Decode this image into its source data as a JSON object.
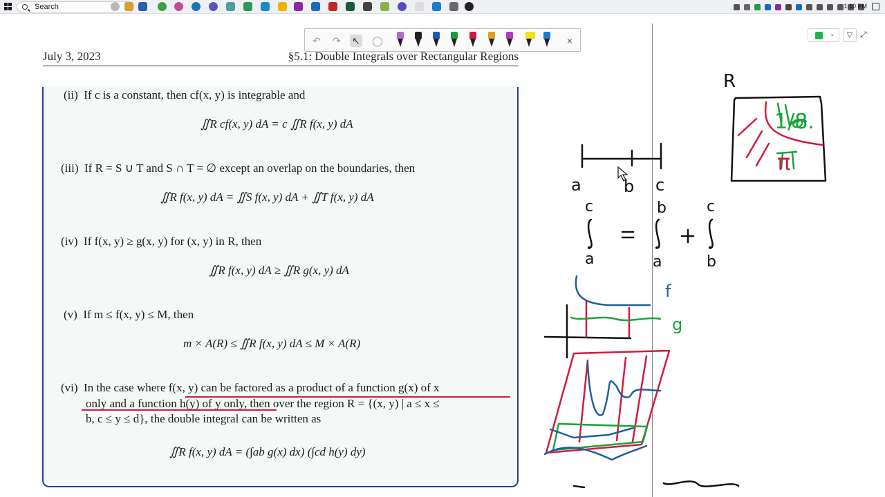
{
  "taskbar": {
    "search_label": "Search",
    "clock": "1:10 PM"
  },
  "document": {
    "header_date": "July 3, 2023",
    "header_title": "§5.1: Double Integrals over Rectangular Regions",
    "items": [
      {
        "num": "(ii)",
        "text": "If c is a constant, then cf(x, y) is integrable and",
        "equation": "∬R cf(x, y) dA = c ∬R f(x, y) dA"
      },
      {
        "num": "(iii)",
        "text": "If R = S ∪ T and S ∩ T = ∅ except an overlap on the boundaries, then",
        "equation": "∬R f(x, y) dA = ∬S f(x, y) dA + ∬T f(x, y) dA"
      },
      {
        "num": "(iv)",
        "text": "If f(x, y) ≥ g(x, y) for (x, y) in R, then",
        "equation": "∬R f(x, y) dA ≥ ∬R g(x, y) dA"
      },
      {
        "num": "(v)",
        "text": "If m ≤ f(x, y) ≤ M, then",
        "equation": "m × A(R) ≤ ∬R f(x, y) dA ≤ M × A(R)"
      },
      {
        "num": "(vi)",
        "text_line1": "In the case where f(x, y) can be factored as a product of a function g(x) of x",
        "text_line2": "only and a function h(y) of y only, then over the region R = {(x, y) | a ≤ x ≤",
        "text_line3": "b, c ≤ y ≤ d}, the double integral can be written as",
        "equation": "∬R f(x, y) dA = (∫ab g(x) dx) (∫cd h(y) dy)"
      }
    ]
  },
  "handwriting": {
    "R_label": "R",
    "interval_labels": [
      "a",
      "b",
      "c"
    ],
    "integral_bounds": [
      "c",
      "a",
      "b",
      "a",
      "c",
      "b"
    ],
    "f_label": "f",
    "g_label": "g",
    "region_notes": [
      "1/8.",
      "π"
    ]
  },
  "colors": {
    "box_border": "#2a3aa0",
    "box_fill": "#f4f9f8",
    "ink_black": "#111111",
    "ink_red": "#d11a3f",
    "ink_green": "#1aa33a",
    "ink_blue": "#1f5f9a"
  }
}
